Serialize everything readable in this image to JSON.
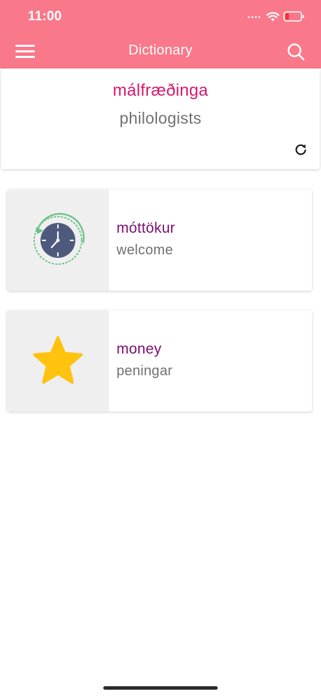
{
  "status_bar": {
    "time": "11:00"
  },
  "nav": {
    "title": "Dictionary",
    "menu_icon": "hamburger-menu-icon",
    "search_icon": "search-icon"
  },
  "word_of_day": {
    "word": "málfræðinga",
    "translation": "philologists",
    "refresh_icon": "refresh-icon"
  },
  "cards": [
    {
      "icon": "history-clock-icon",
      "title": "móttökur",
      "subtitle": "welcome"
    },
    {
      "icon": "star-icon",
      "title": "money",
      "subtitle": "peningar"
    }
  ],
  "colors": {
    "header": "#f9788a",
    "word_accent": "#d6196e",
    "card_title": "#7b0f70",
    "secondary_text": "#707070",
    "clock_face": "#4e5a7d",
    "clock_arrow": "#6cc38a",
    "star": "#ffc20e"
  }
}
